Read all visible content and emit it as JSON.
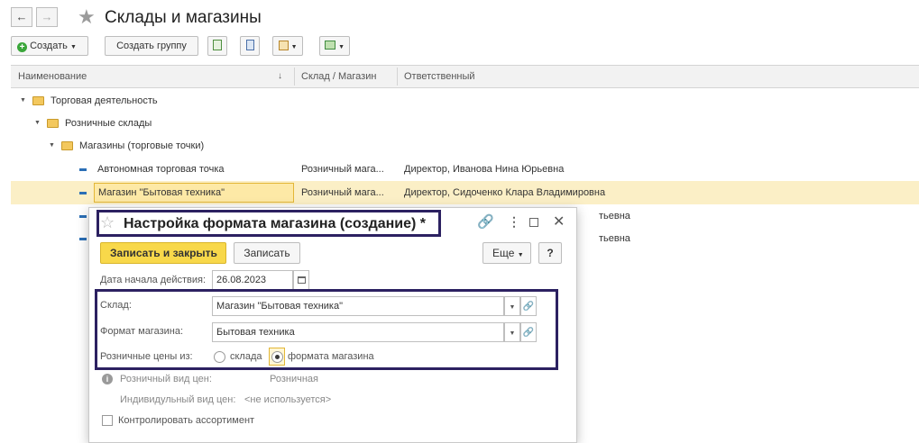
{
  "window": {
    "title": "Склады и магазины",
    "back_icon": "←",
    "forward_icon": "→",
    "star_icon": "★"
  },
  "toolbar": {
    "create_label": "Создать",
    "create_group_label": "Создать группу"
  },
  "grid": {
    "columns": [
      "Наименование",
      "Склад / Магазин",
      "Ответственный"
    ],
    "sort_icon": "↓",
    "rows": [
      {
        "name": "Торговая деятельность",
        "type": "",
        "responsible": ""
      },
      {
        "name": "Розничные склады",
        "type": "",
        "responsible": ""
      },
      {
        "name": "Магазины (торговые точки)",
        "type": "",
        "responsible": ""
      },
      {
        "name": "Автономная торговая точка",
        "type": "Розничный мага...",
        "responsible": "Директор, Иванова Нина Юрьевна"
      },
      {
        "name": "Магазин \"Бытовая техника\"",
        "type": "Розничный мага...",
        "responsible": "Директор, Сидоченко Клара Владимировна"
      },
      {
        "name": "",
        "type": "",
        "responsible": "тьевна"
      },
      {
        "name": "",
        "type": "",
        "responsible": "тьевна"
      }
    ]
  },
  "dialog": {
    "title": "Настройка формата магазина (создание) *",
    "save_close_label": "Записать и закрыть",
    "save_label": "Записать",
    "more_label": "Еще",
    "help_label": "?",
    "start_date_label": "Дата начала действия:",
    "start_date_value": "26.08.2023",
    "warehouse_label": "Склад:",
    "warehouse_value": "Магазин \"Бытовая техника\"",
    "format_label": "Формат магазина:",
    "format_value": "Бытовая техника",
    "retail_prices_label": "Розничные цены из:",
    "radio_warehouse": "склада",
    "radio_format": "формата магазина",
    "price_type_label": "Розничный вид цен:",
    "price_type_value": "Розничная",
    "individual_price_label": "Индивидульный вид цен:",
    "individual_price_value": "<не используется>",
    "control_assortment_label": "Контролировать ассортимент"
  },
  "colors": {
    "accent_yellow": "#f8d84a",
    "selection": "#fbefc6",
    "highlight_box": "#2c2161",
    "folder": "#f3c85e"
  }
}
